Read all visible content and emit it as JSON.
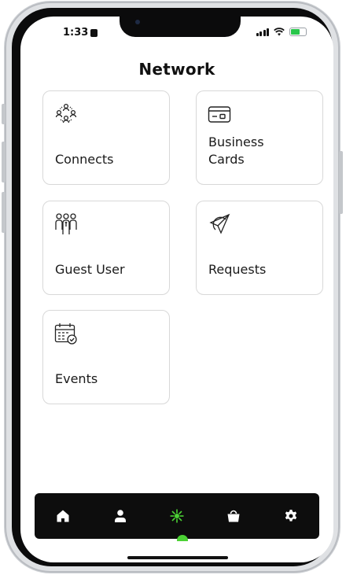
{
  "status_bar": {
    "time": "1:33"
  },
  "header": {
    "title": "Network"
  },
  "tiles": [
    {
      "id": "connects",
      "label": "Connects",
      "icon": "people-network-icon"
    },
    {
      "id": "business-cards",
      "label": "Business\nCards",
      "icon": "business-card-icon"
    },
    {
      "id": "guest-user",
      "label": "Guest User",
      "icon": "guest-users-icon"
    },
    {
      "id": "requests",
      "label": "Requests",
      "icon": "paper-plane-icon"
    },
    {
      "id": "events",
      "label": "Events",
      "icon": "calendar-check-icon"
    }
  ],
  "tab_bar": {
    "items": [
      "home-icon",
      "profile-icon",
      "network-icon",
      "shop-bag-icon",
      "settings-icon"
    ],
    "active": "network-icon",
    "active_color": "#4bd134"
  },
  "colors": {
    "accent": "#4bd134",
    "tabbar_bg": "#0d0d0d",
    "card_border": "#d8d8d8"
  }
}
